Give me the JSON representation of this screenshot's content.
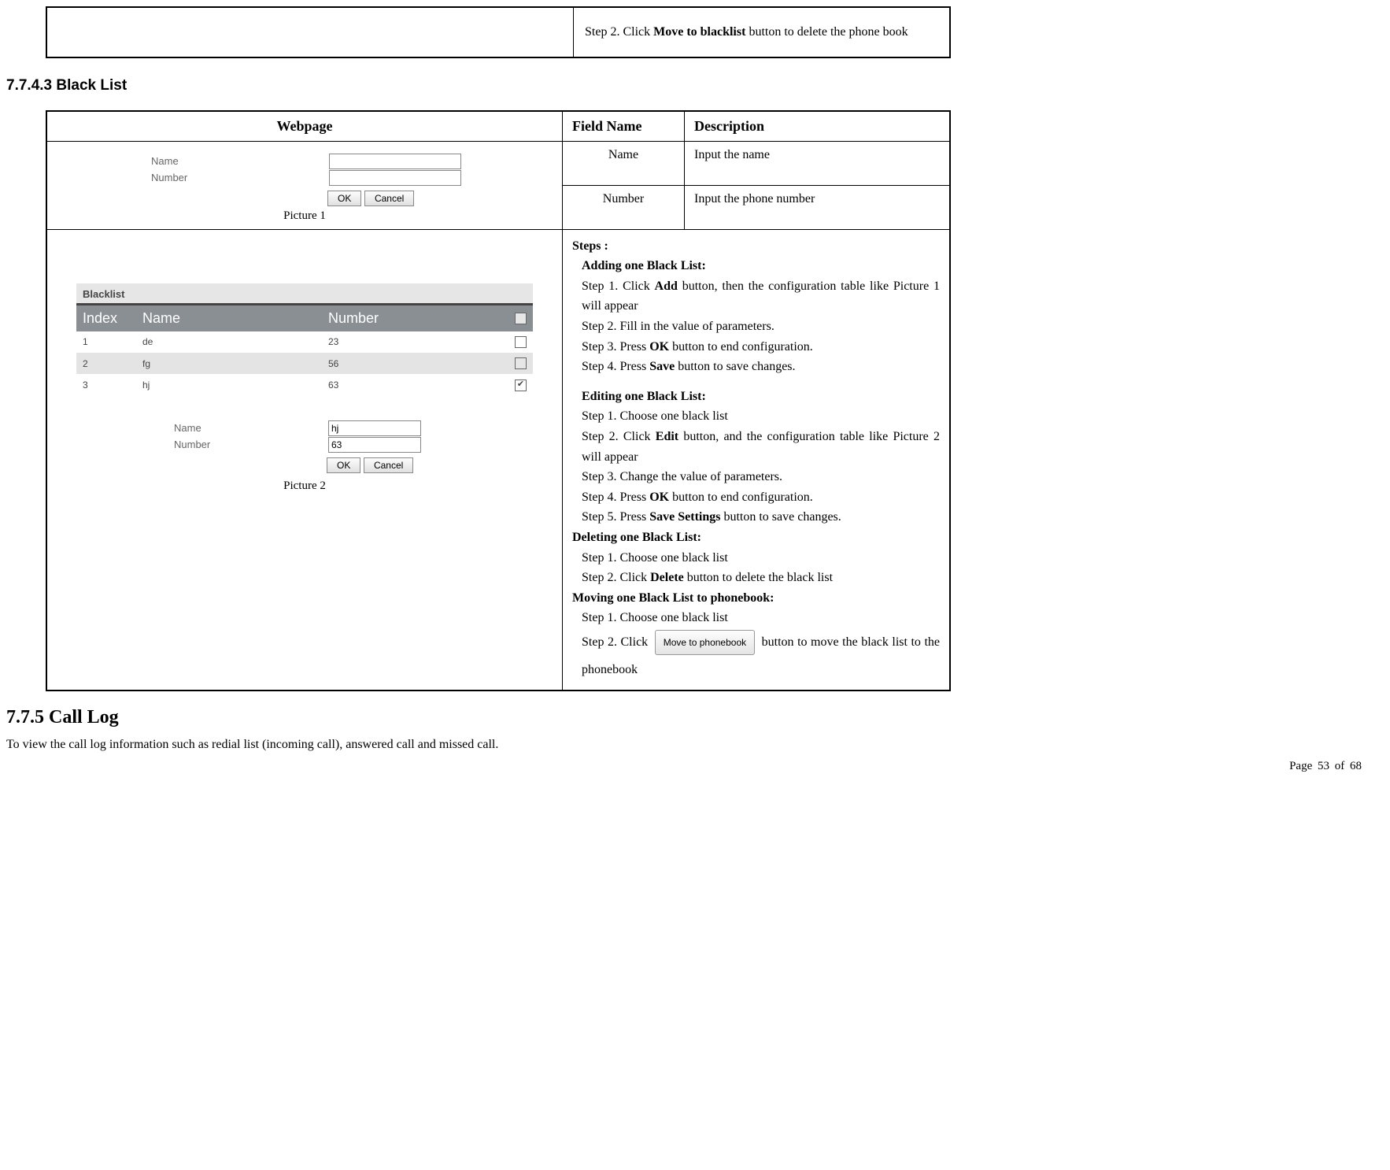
{
  "top_box": {
    "step2_prefix": "Step 2. Click ",
    "step2_bold": "Move to blacklist",
    "step2_suffix": " button to delete the phone book"
  },
  "section_blacklist_heading": "7.7.4.3  Black List",
  "headers": {
    "webpage": "Webpage",
    "field_name": "Field Name",
    "description": "Description"
  },
  "picture1": {
    "name_label": "Name",
    "number_label": "Number",
    "ok": "OK",
    "cancel": "Cancel",
    "caption": "Picture 1"
  },
  "rows": [
    {
      "field": "Name",
      "desc": "Input the name"
    },
    {
      "field": "Number",
      "desc": "Input the phone number"
    }
  ],
  "picture2": {
    "title": "Blacklist",
    "cols": {
      "index": "Index",
      "name": "Name",
      "number": "Number"
    },
    "data": [
      {
        "index": "1",
        "name": "de",
        "number": "23",
        "checked": false,
        "alt": false
      },
      {
        "index": "2",
        "name": "fg",
        "number": "56",
        "checked": false,
        "alt": true
      },
      {
        "index": "3",
        "name": "hj",
        "number": "63",
        "checked": true,
        "alt": false
      }
    ],
    "edit_name_label": "Name",
    "edit_name_value": "hj",
    "edit_number_label": "Number",
    "edit_number_value": "63",
    "ok": "OK",
    "cancel": "Cancel",
    "caption": "Picture 2"
  },
  "steps": {
    "title": "Steps :",
    "add_heading": "Adding one Black List:",
    "add_s1a": "Step 1. Click ",
    "add_s1b": "Add",
    "add_s1c": " button, then the configuration table like Picture 1 will appear",
    "add_s2": "Step 2. Fill in the value of parameters.",
    "add_s3a": "Step 3. Press ",
    "add_s3b": "OK",
    "add_s3c": " button to end configuration.",
    "add_s4a": "Step 4. Press ",
    "add_s4b": "Save",
    "add_s4c": " button to save changes.",
    "edit_heading": "Editing one Black List:",
    "edit_s1": "Step 1. Choose one black list",
    "edit_s2a": "Step 2. Click ",
    "edit_s2b": "Edit",
    "edit_s2c": " button, and the configuration table like Picture 2 will appear",
    "edit_s3": "Step 3. Change the value of parameters.",
    "edit_s4a": "Step 4. Press ",
    "edit_s4b": "OK",
    "edit_s4c": " button to end configuration.",
    "edit_s5a": "Step 5. Press ",
    "edit_s5b": "Save Settings",
    "edit_s5c": " button to save changes.",
    "del_heading": "Deleting one Black List:",
    "del_s1": "Step 1. Choose one black list",
    "del_s2a": "Step 2. Click ",
    "del_s2b": "Delete",
    "del_s2c": " button to delete the black list",
    "move_heading": "Moving one Black List to phonebook:",
    "move_s1": "Step 1. Choose one black list",
    "move_s2a": "Step 2. Click ",
    "move_btn": "Move to phonebook",
    "move_s2b": " button to move the black list to the phonebook"
  },
  "section_calllog_heading": "7.7.5    Call Log",
  "calllog_text": "To view the call log information such as redial list (incoming call), answered call and missed call.",
  "page_number": "Page 53 of 68"
}
